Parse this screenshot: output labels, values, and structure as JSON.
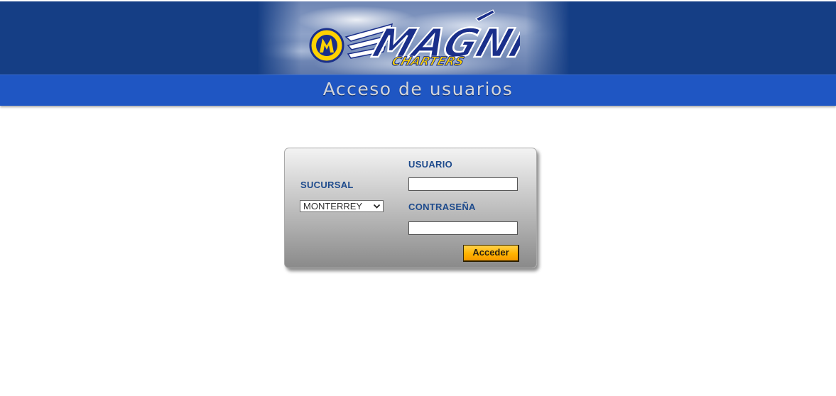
{
  "header": {
    "logo": {
      "icon": "magni-charters-logo",
      "brand_text": "MAGNÍ",
      "sub_text": "CHARTERS"
    },
    "page_title": "Acceso de usuarios"
  },
  "login_form": {
    "usuario_label": "USUARIO",
    "usuario_value": "",
    "sucursal_label": "SUCURSAL",
    "sucursal_selected": "MONTERREY",
    "contrasena_label": "CONTRASEÑA",
    "contrasena_value": "",
    "submit_label": "Acceder"
  },
  "colors": {
    "header_dark": "#153e85",
    "header_bar": "#1f56c3",
    "label_blue": "#1d4a8c",
    "button_orange": "#ffb300"
  }
}
